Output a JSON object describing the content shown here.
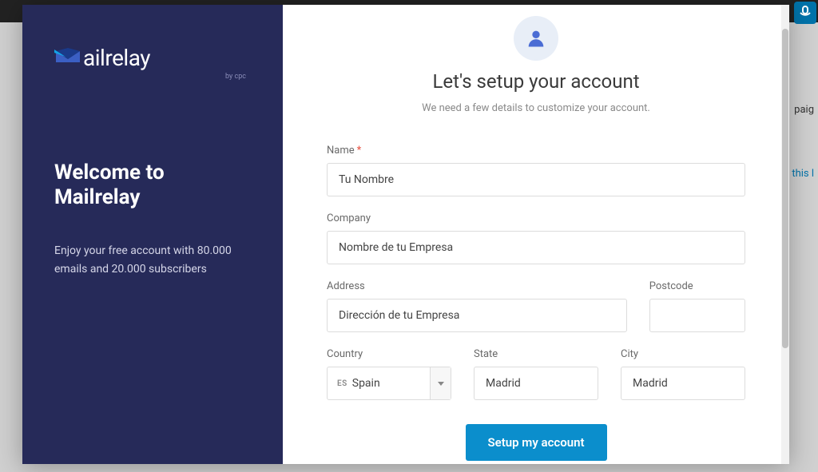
{
  "brand": {
    "logo_text": "ailrelay",
    "logo_sub": "by cpc"
  },
  "sidebar": {
    "welcome_title": "Welcome to Mailrelay",
    "welcome_desc": "Enjoy your free account with 80.000 emails and 20.000 subscribers"
  },
  "setup": {
    "title": "Let's setup your account",
    "subtitle": "We need a few details to customize your account.",
    "labels": {
      "name": "Name",
      "company": "Company",
      "address": "Address",
      "postcode": "Postcode",
      "country": "Country",
      "state": "State",
      "city": "City"
    },
    "values": {
      "name": "Tu Nombre",
      "company": "Nombre de tu Empresa",
      "address": "Dirección de tu Empresa",
      "postcode": "",
      "country_code": "ES",
      "country_name": "Spain",
      "state": "Madrid",
      "city": "Madrid"
    },
    "submit_label": "Setup my account"
  },
  "background": {
    "text1": "paig",
    "text2": "this l"
  }
}
